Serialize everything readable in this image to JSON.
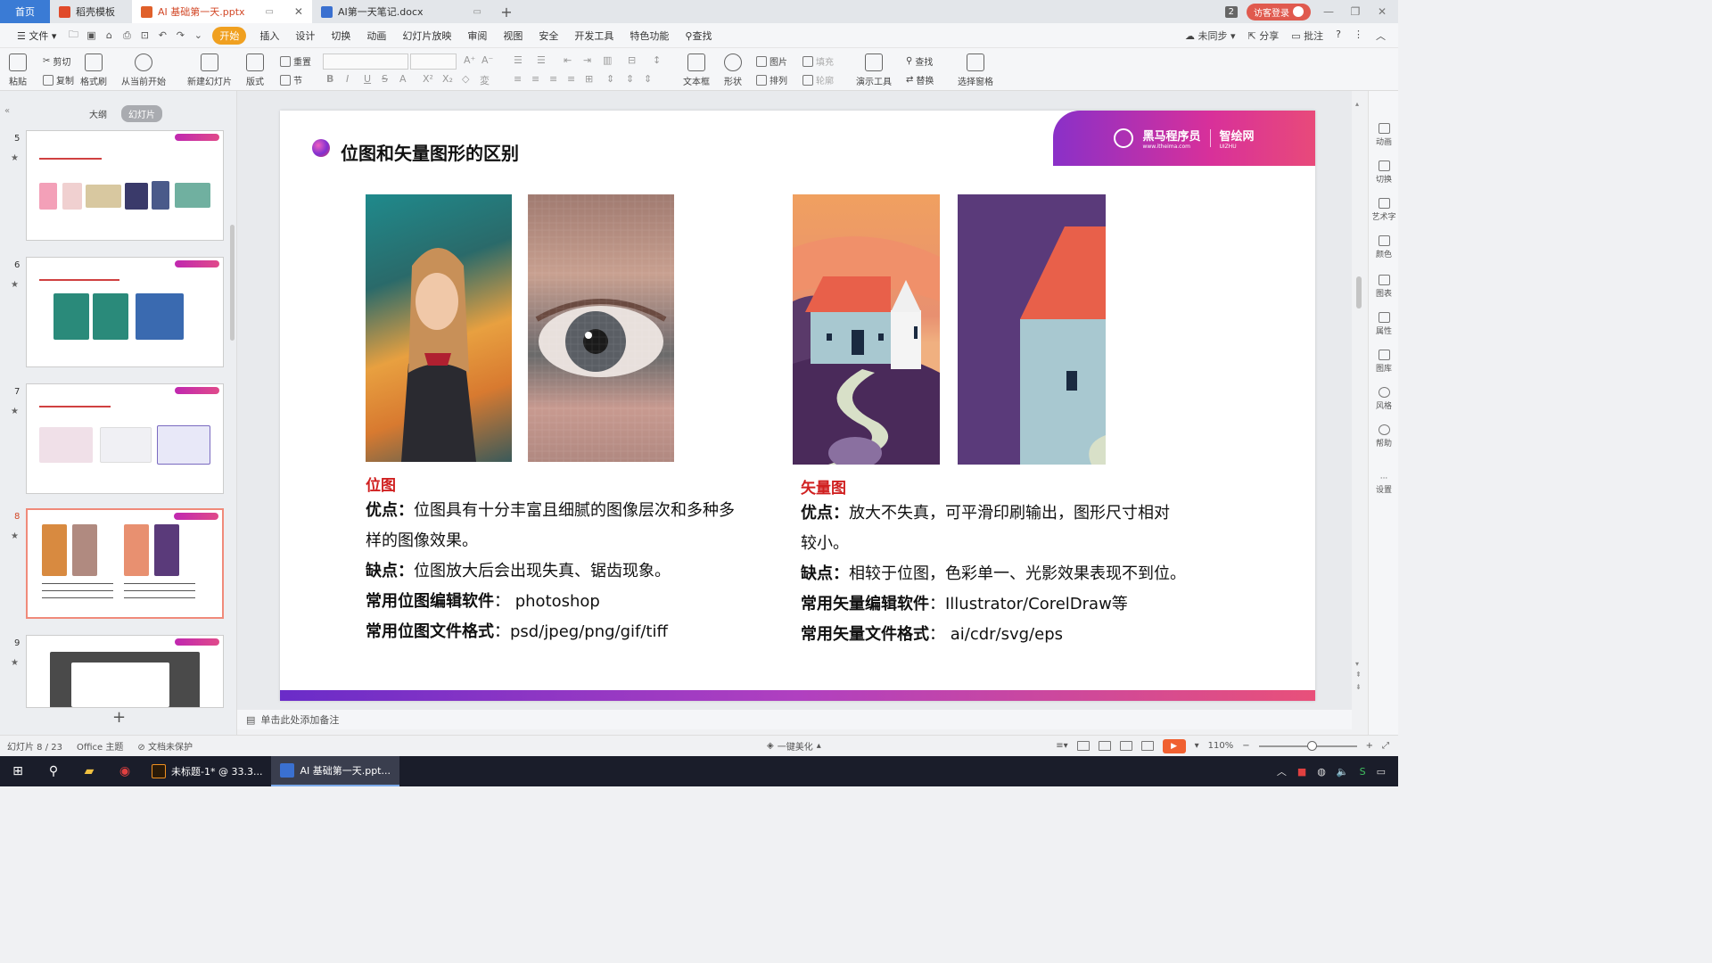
{
  "tabs": [
    {
      "label": "首页",
      "kind": "home"
    },
    {
      "label": "稻壳模板",
      "kind": "normal",
      "icon": "wps-icon"
    },
    {
      "label": "AI 基础第一天.pptx",
      "kind": "active",
      "icon": "pptx-icon"
    },
    {
      "label": "AI第一天笔记.docx",
      "kind": "doc",
      "icon": "docx-icon"
    }
  ],
  "tabbar_right": {
    "count": "2",
    "login": "访客登录"
  },
  "menu": {
    "file": "文件",
    "items": [
      "开始",
      "插入",
      "设计",
      "切换",
      "动画",
      "幻灯片放映",
      "审阅",
      "视图",
      "安全",
      "开发工具",
      "特色功能"
    ],
    "search": "查找",
    "right": [
      "未同步",
      "分享",
      "批注"
    ]
  },
  "ribbon": {
    "paste": "粘贴",
    "cut": "剪切",
    "copy": "复制",
    "format_painter": "格式刷",
    "from_current": "从当前开始",
    "new_slide": "新建幻灯片",
    "layout": "版式",
    "reset": "重置",
    "section": "节",
    "picture": "图片",
    "fill": "填充",
    "textbox": "文本框",
    "shape": "形状",
    "arrange": "排列",
    "outline": "轮廓",
    "presenter_tools": "演示工具",
    "find": "查找",
    "replace": "替换",
    "select_pane": "选择窗格"
  },
  "panel": {
    "tab_outline": "大纲",
    "tab_slides": "幻灯片",
    "thumbs": [
      {
        "num": "5"
      },
      {
        "num": "6"
      },
      {
        "num": "7"
      },
      {
        "num": "8",
        "selected": true
      },
      {
        "num": "9"
      }
    ]
  },
  "slide": {
    "title": "位图和矢量图形的区别",
    "logo_left": "黑马程序员",
    "logo_left_sub": "www.itheima.com",
    "logo_right": "智绘网",
    "logo_right_sub": "UIZHU",
    "bitmap": {
      "heading": "位图",
      "pros_label": "优点：",
      "pros_text1": "位图具有十分丰富且细腻的图像层次和多种多",
      "pros_text2": "样的图像效果。",
      "cons_label": "缺点：",
      "cons_text": "位图放大后会出现失真、锯齿现象。",
      "software_label": "常用位图编辑软件",
      "software_text": "： photoshop",
      "format_label": "常用位图文件格式",
      "format_text": "：psd/jpeg/png/gif/tiff"
    },
    "vector": {
      "heading": "矢量图",
      "pros_label": "优点：",
      "pros_text1": "放大不失真，可平滑印刷输出，图形尺寸相对",
      "pros_text2": "较小。",
      "cons_label": "缺点：",
      "cons_text": "相较于位图，色彩单一、光影效果表现不到位。",
      "software_label": "常用矢量编辑软件",
      "software_text": "：Illustrator/CorelDraw等",
      "format_label": "常用矢量文件格式",
      "format_text": "： ai/cdr/svg/eps"
    }
  },
  "rightbar": [
    "动画",
    "切换",
    "艺术字",
    "颜色",
    "图表",
    "属性",
    "图库",
    "风格",
    "帮助",
    "设置"
  ],
  "notes": "单击此处添加备注",
  "status": {
    "slide_count": "幻灯片 8 / 23",
    "theme": "Office 主题",
    "protect": "文档未保护",
    "beautify": "一键美化",
    "zoom": "110%"
  },
  "taskbar": {
    "apps": [
      {
        "label": "未标题-1* @ 33.3...",
        "icon": "illustrator-icon",
        "active": false
      },
      {
        "label": "AI 基础第一天.ppt...",
        "icon": "wps-presentation-icon",
        "active": true
      }
    ]
  },
  "colors": {
    "accent_red": "#d02020",
    "brand_orange": "#f0a020",
    "logo_gradient_start": "#8a30c8",
    "logo_gradient_end": "#e84a7a"
  }
}
